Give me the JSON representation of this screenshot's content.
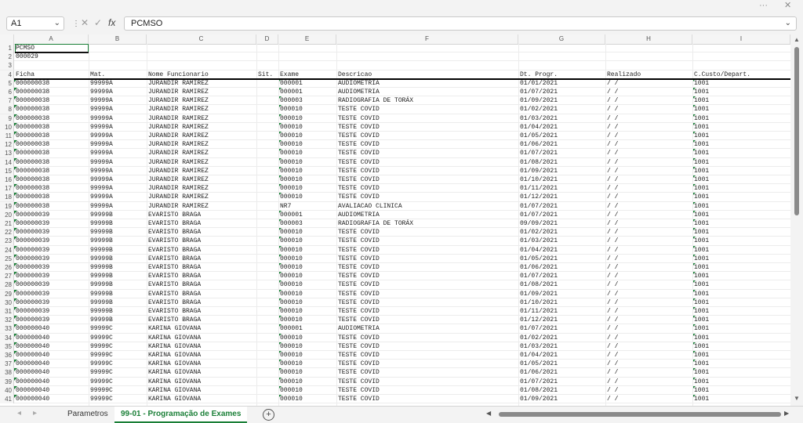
{
  "window": {
    "more_icon": "more-options-icon",
    "close_icon": "close-icon"
  },
  "formula_bar": {
    "cell_ref": "A1",
    "content": "PCMSO"
  },
  "columns": [
    "A",
    "B",
    "C",
    "D",
    "E",
    "F",
    "G",
    "H",
    "I"
  ],
  "cells": {
    "a1": "PCMSO",
    "a2": "000029"
  },
  "headers": [
    "Ficha",
    "Mat.",
    "Nome Funcionario",
    "Sit.",
    "Exame",
    "Descricao",
    "Dt. Progr.",
    "Realizado",
    "C.Custo/Depart."
  ],
  "rows": [
    [
      "000000038",
      "99999A",
      "JURANDIR RAMIREZ",
      "",
      "000001",
      "AUDIOMETRIA",
      "01/01/2021",
      "/  /",
      "1001"
    ],
    [
      "000000038",
      "99999A",
      "JURANDIR RAMIREZ",
      "",
      "000001",
      "AUDIOMETRIA",
      "01/07/2021",
      "/  /",
      "1001"
    ],
    [
      "000000038",
      "99999A",
      "JURANDIR RAMIREZ",
      "",
      "000003",
      "RADIOGRAFIA DE TORÁX",
      "01/09/2021",
      "/  /",
      "1001"
    ],
    [
      "000000038",
      "99999A",
      "JURANDIR RAMIREZ",
      "",
      "000010",
      "TESTE COVID",
      "01/02/2021",
      "/  /",
      "1001"
    ],
    [
      "000000038",
      "99999A",
      "JURANDIR RAMIREZ",
      "",
      "000010",
      "TESTE COVID",
      "01/03/2021",
      "/  /",
      "1001"
    ],
    [
      "000000038",
      "99999A",
      "JURANDIR RAMIREZ",
      "",
      "000010",
      "TESTE COVID",
      "01/04/2021",
      "/  /",
      "1001"
    ],
    [
      "000000038",
      "99999A",
      "JURANDIR RAMIREZ",
      "",
      "000010",
      "TESTE COVID",
      "01/05/2021",
      "/  /",
      "1001"
    ],
    [
      "000000038",
      "99999A",
      "JURANDIR RAMIREZ",
      "",
      "000010",
      "TESTE COVID",
      "01/06/2021",
      "/  /",
      "1001"
    ],
    [
      "000000038",
      "99999A",
      "JURANDIR RAMIREZ",
      "",
      "000010",
      "TESTE COVID",
      "01/07/2021",
      "/  /",
      "1001"
    ],
    [
      "000000038",
      "99999A",
      "JURANDIR RAMIREZ",
      "",
      "000010",
      "TESTE COVID",
      "01/08/2021",
      "/  /",
      "1001"
    ],
    [
      "000000038",
      "99999A",
      "JURANDIR RAMIREZ",
      "",
      "000010",
      "TESTE COVID",
      "01/09/2021",
      "/  /",
      "1001"
    ],
    [
      "000000038",
      "99999A",
      "JURANDIR RAMIREZ",
      "",
      "000010",
      "TESTE COVID",
      "01/10/2021",
      "/  /",
      "1001"
    ],
    [
      "000000038",
      "99999A",
      "JURANDIR RAMIREZ",
      "",
      "000010",
      "TESTE COVID",
      "01/11/2021",
      "/  /",
      "1001"
    ],
    [
      "000000038",
      "99999A",
      "JURANDIR RAMIREZ",
      "",
      "000010",
      "TESTE COVID",
      "01/12/2021",
      "/  /",
      "1001"
    ],
    [
      "000000038",
      "99999A",
      "JURANDIR RAMIREZ",
      "",
      "NR7",
      "AVALIACAO CLINICA",
      "01/07/2021",
      "/  /",
      "1001"
    ],
    [
      "000000039",
      "99999B",
      "EVARISTO BRAGA",
      "",
      "000001",
      "AUDIOMETRIA",
      "01/07/2021",
      "/  /",
      "1001"
    ],
    [
      "000000039",
      "99999B",
      "EVARISTO BRAGA",
      "",
      "000003",
      "RADIOGRAFIA DE TORÁX",
      "09/09/2021",
      "/  /",
      "1001"
    ],
    [
      "000000039",
      "99999B",
      "EVARISTO BRAGA",
      "",
      "000010",
      "TESTE COVID",
      "01/02/2021",
      "/  /",
      "1001"
    ],
    [
      "000000039",
      "99999B",
      "EVARISTO BRAGA",
      "",
      "000010",
      "TESTE COVID",
      "01/03/2021",
      "/  /",
      "1001"
    ],
    [
      "000000039",
      "99999B",
      "EVARISTO BRAGA",
      "",
      "000010",
      "TESTE COVID",
      "01/04/2021",
      "/  /",
      "1001"
    ],
    [
      "000000039",
      "99999B",
      "EVARISTO BRAGA",
      "",
      "000010",
      "TESTE COVID",
      "01/05/2021",
      "/  /",
      "1001"
    ],
    [
      "000000039",
      "99999B",
      "EVARISTO BRAGA",
      "",
      "000010",
      "TESTE COVID",
      "01/06/2021",
      "/  /",
      "1001"
    ],
    [
      "000000039",
      "99999B",
      "EVARISTO BRAGA",
      "",
      "000010",
      "TESTE COVID",
      "01/07/2021",
      "/  /",
      "1001"
    ],
    [
      "000000039",
      "99999B",
      "EVARISTO BRAGA",
      "",
      "000010",
      "TESTE COVID",
      "01/08/2021",
      "/  /",
      "1001"
    ],
    [
      "000000039",
      "99999B",
      "EVARISTO BRAGA",
      "",
      "000010",
      "TESTE COVID",
      "01/09/2021",
      "/  /",
      "1001"
    ],
    [
      "000000039",
      "99999B",
      "EVARISTO BRAGA",
      "",
      "000010",
      "TESTE COVID",
      "01/10/2021",
      "/  /",
      "1001"
    ],
    [
      "000000039",
      "99999B",
      "EVARISTO BRAGA",
      "",
      "000010",
      "TESTE COVID",
      "01/11/2021",
      "/  /",
      "1001"
    ],
    [
      "000000039",
      "99999B",
      "EVARISTO BRAGA",
      "",
      "000010",
      "TESTE COVID",
      "01/12/2021",
      "/  /",
      "1001"
    ],
    [
      "000000040",
      "99999C",
      "KARINA GIOVANA",
      "",
      "000001",
      "AUDIOMETRIA",
      "01/07/2021",
      "/  /",
      "1001"
    ],
    [
      "000000040",
      "99999C",
      "KARINA GIOVANA",
      "",
      "000010",
      "TESTE COVID",
      "01/02/2021",
      "/  /",
      "1001"
    ],
    [
      "000000040",
      "99999C",
      "KARINA GIOVANA",
      "",
      "000010",
      "TESTE COVID",
      "01/03/2021",
      "/  /",
      "1001"
    ],
    [
      "000000040",
      "99999C",
      "KARINA GIOVANA",
      "",
      "000010",
      "TESTE COVID",
      "01/04/2021",
      "/  /",
      "1001"
    ],
    [
      "000000040",
      "99999C",
      "KARINA GIOVANA",
      "",
      "000010",
      "TESTE COVID",
      "01/05/2021",
      "/  /",
      "1001"
    ],
    [
      "000000040",
      "99999C",
      "KARINA GIOVANA",
      "",
      "000010",
      "TESTE COVID",
      "01/06/2021",
      "/  /",
      "1001"
    ],
    [
      "000000040",
      "99999C",
      "KARINA GIOVANA",
      "",
      "000010",
      "TESTE COVID",
      "01/07/2021",
      "/  /",
      "1001"
    ],
    [
      "000000040",
      "99999C",
      "KARINA GIOVANA",
      "",
      "000010",
      "TESTE COVID",
      "01/08/2021",
      "/  /",
      "1001"
    ],
    [
      "000000040",
      "99999C",
      "KARINA GIOVANA",
      "",
      "000010",
      "TESTE COVID",
      "01/09/2021",
      "/  /",
      "1001"
    ]
  ],
  "sheet_tabs": [
    "Parametros",
    "99-01 - Programação de Exames"
  ],
  "active_tab": "99-01 - Programação de Exames",
  "accent_color": "#1a7f37"
}
